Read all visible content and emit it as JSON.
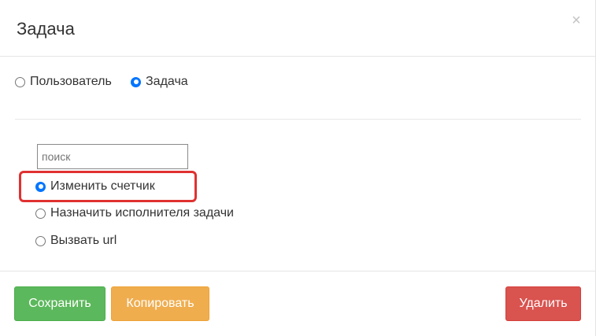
{
  "modal": {
    "title": "Задача",
    "close_label": "×"
  },
  "type_selector": {
    "options": [
      {
        "label": "Пользователь",
        "checked": false
      },
      {
        "label": "Задача",
        "checked": true
      }
    ]
  },
  "search": {
    "placeholder": "поиск",
    "value": ""
  },
  "actions": {
    "options": [
      {
        "label": "Изменить счетчик",
        "checked": true
      },
      {
        "label": "Назначить исполнителя задачи",
        "checked": false
      },
      {
        "label": "Вызвать url",
        "checked": false
      }
    ]
  },
  "footer": {
    "save_label": "Сохранить",
    "copy_label": "Копировать",
    "delete_label": "Удалить"
  },
  "colors": {
    "save": "#5cb85c",
    "copy": "#f0ad4e",
    "delete": "#d9534f",
    "highlight": "#e03131",
    "radio_checked": "#0075ff"
  }
}
